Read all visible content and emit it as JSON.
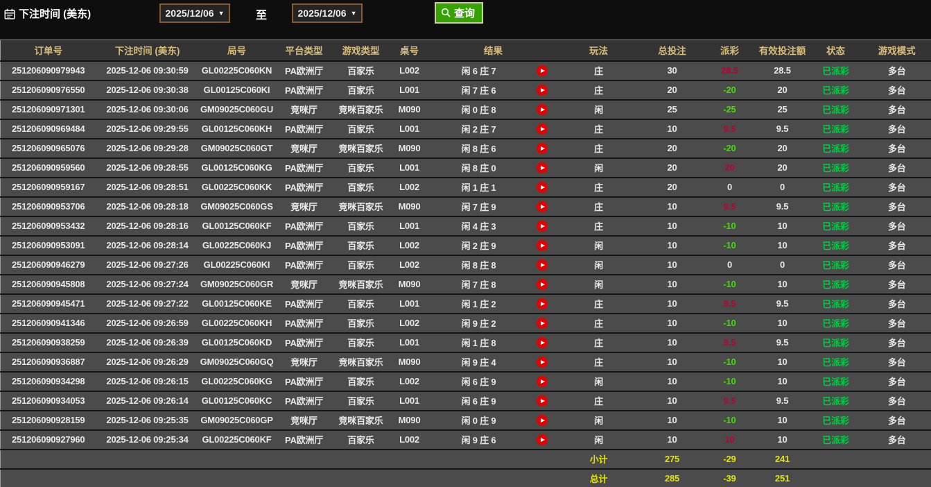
{
  "toolbar": {
    "title": "下注时间 (美东)",
    "date_from": "2025/12/06",
    "date_to": "2025/12/06",
    "to_label": "至",
    "search_label": "查询"
  },
  "colors": {
    "payout_win_red": "#c00031",
    "payout_loss_green": "#44dd00",
    "status_green": "#00cc44",
    "totals_yellow": "#e4e400",
    "header_text_tan": "#d8bc7a",
    "search_button_green": "#36a302",
    "date_border_brown": "#8a5a28",
    "play_button_red": "#e60000"
  },
  "table": {
    "headers": [
      "订单号",
      "下注时间 (美东)",
      "局号",
      "平台类型",
      "游戏类型",
      "桌号",
      "结果",
      "玩法",
      "总投注",
      "派彩",
      "有效投注额",
      "状态",
      "游戏模式"
    ],
    "rows": [
      {
        "order_id": "251206090979943",
        "bet_time": "2025-12-06 09:30:59",
        "round_id": "GL00225C060KN",
        "platform": "PA欧洲厅",
        "game_type": "百家乐",
        "table_no": "L002",
        "result": "闲 6 庄 7",
        "play_type": "庄",
        "total_bet": "30",
        "payout": "28.5",
        "payout_class": "win",
        "valid_bet": "28.5",
        "status": "已派彩",
        "mode": "多台"
      },
      {
        "order_id": "251206090976550",
        "bet_time": "2025-12-06 09:30:38",
        "round_id": "GL00125C060KI",
        "platform": "PA欧洲厅",
        "game_type": "百家乐",
        "table_no": "L001",
        "result": "闲 7 庄 6",
        "play_type": "庄",
        "total_bet": "20",
        "payout": "-20",
        "payout_class": "loss",
        "valid_bet": "20",
        "status": "已派彩",
        "mode": "多台"
      },
      {
        "order_id": "251206090971301",
        "bet_time": "2025-12-06 09:30:06",
        "round_id": "GM09025C060GU",
        "platform": "竞咪厅",
        "game_type": "竞咪百家乐",
        "table_no": "M090",
        "result": "闲 0 庄 8",
        "play_type": "闲",
        "total_bet": "25",
        "payout": "-25",
        "payout_class": "loss",
        "valid_bet": "25",
        "status": "已派彩",
        "mode": "多台"
      },
      {
        "order_id": "251206090969484",
        "bet_time": "2025-12-06 09:29:55",
        "round_id": "GL00125C060KH",
        "platform": "PA欧洲厅",
        "game_type": "百家乐",
        "table_no": "L001",
        "result": "闲 2 庄 7",
        "play_type": "庄",
        "total_bet": "10",
        "payout": "9.5",
        "payout_class": "win",
        "valid_bet": "9.5",
        "status": "已派彩",
        "mode": "多台"
      },
      {
        "order_id": "251206090965076",
        "bet_time": "2025-12-06 09:29:28",
        "round_id": "GM09025C060GT",
        "platform": "竞咪厅",
        "game_type": "竞咪百家乐",
        "table_no": "M090",
        "result": "闲 8 庄 6",
        "play_type": "庄",
        "total_bet": "20",
        "payout": "-20",
        "payout_class": "loss",
        "valid_bet": "20",
        "status": "已派彩",
        "mode": "多台"
      },
      {
        "order_id": "251206090959560",
        "bet_time": "2025-12-06 09:28:55",
        "round_id": "GL00125C060KG",
        "platform": "PA欧洲厅",
        "game_type": "百家乐",
        "table_no": "L001",
        "result": "闲 8 庄 0",
        "play_type": "闲",
        "total_bet": "20",
        "payout": "20",
        "payout_class": "win",
        "valid_bet": "20",
        "status": "已派彩",
        "mode": "多台"
      },
      {
        "order_id": "251206090959167",
        "bet_time": "2025-12-06 09:28:51",
        "round_id": "GL00225C060KK",
        "platform": "PA欧洲厅",
        "game_type": "百家乐",
        "table_no": "L002",
        "result": "闲 1 庄 1",
        "play_type": "庄",
        "total_bet": "20",
        "payout": "0",
        "payout_class": "zero",
        "valid_bet": "0",
        "status": "已派彩",
        "mode": "多台"
      },
      {
        "order_id": "251206090953706",
        "bet_time": "2025-12-06 09:28:18",
        "round_id": "GM09025C060GS",
        "platform": "竞咪厅",
        "game_type": "竞咪百家乐",
        "table_no": "M090",
        "result": "闲 7 庄 9",
        "play_type": "庄",
        "total_bet": "10",
        "payout": "9.5",
        "payout_class": "win",
        "valid_bet": "9.5",
        "status": "已派彩",
        "mode": "多台"
      },
      {
        "order_id": "251206090953432",
        "bet_time": "2025-12-06 09:28:16",
        "round_id": "GL00125C060KF",
        "platform": "PA欧洲厅",
        "game_type": "百家乐",
        "table_no": "L001",
        "result": "闲 4 庄 3",
        "play_type": "庄",
        "total_bet": "10",
        "payout": "-10",
        "payout_class": "loss",
        "valid_bet": "10",
        "status": "已派彩",
        "mode": "多台"
      },
      {
        "order_id": "251206090953091",
        "bet_time": "2025-12-06 09:28:14",
        "round_id": "GL00225C060KJ",
        "platform": "PA欧洲厅",
        "game_type": "百家乐",
        "table_no": "L002",
        "result": "闲 2 庄 9",
        "play_type": "闲",
        "total_bet": "10",
        "payout": "-10",
        "payout_class": "loss",
        "valid_bet": "10",
        "status": "已派彩",
        "mode": "多台"
      },
      {
        "order_id": "251206090946279",
        "bet_time": "2025-12-06 09:27:26",
        "round_id": "GL00225C060KI",
        "platform": "PA欧洲厅",
        "game_type": "百家乐",
        "table_no": "L002",
        "result": "闲 8 庄 8",
        "play_type": "闲",
        "total_bet": "10",
        "payout": "0",
        "payout_class": "zero",
        "valid_bet": "0",
        "status": "已派彩",
        "mode": "多台"
      },
      {
        "order_id": "251206090945808",
        "bet_time": "2025-12-06 09:27:24",
        "round_id": "GM09025C060GR",
        "platform": "竞咪厅",
        "game_type": "竞咪百家乐",
        "table_no": "M090",
        "result": "闲 7 庄 8",
        "play_type": "闲",
        "total_bet": "10",
        "payout": "-10",
        "payout_class": "loss",
        "valid_bet": "10",
        "status": "已派彩",
        "mode": "多台"
      },
      {
        "order_id": "251206090945471",
        "bet_time": "2025-12-06 09:27:22",
        "round_id": "GL00125C060KE",
        "platform": "PA欧洲厅",
        "game_type": "百家乐",
        "table_no": "L001",
        "result": "闲 1 庄 2",
        "play_type": "庄",
        "total_bet": "10",
        "payout": "9.5",
        "payout_class": "win",
        "valid_bet": "9.5",
        "status": "已派彩",
        "mode": "多台"
      },
      {
        "order_id": "251206090941346",
        "bet_time": "2025-12-06 09:26:59",
        "round_id": "GL00225C060KH",
        "platform": "PA欧洲厅",
        "game_type": "百家乐",
        "table_no": "L002",
        "result": "闲 9 庄 2",
        "play_type": "庄",
        "total_bet": "10",
        "payout": "-10",
        "payout_class": "loss",
        "valid_bet": "10",
        "status": "已派彩",
        "mode": "多台"
      },
      {
        "order_id": "251206090938259",
        "bet_time": "2025-12-06 09:26:39",
        "round_id": "GL00125C060KD",
        "platform": "PA欧洲厅",
        "game_type": "百家乐",
        "table_no": "L001",
        "result": "闲 1 庄 8",
        "play_type": "庄",
        "total_bet": "10",
        "payout": "9.5",
        "payout_class": "win",
        "valid_bet": "9.5",
        "status": "已派彩",
        "mode": "多台"
      },
      {
        "order_id": "251206090936887",
        "bet_time": "2025-12-06 09:26:29",
        "round_id": "GM09025C060GQ",
        "platform": "竞咪厅",
        "game_type": "竞咪百家乐",
        "table_no": "M090",
        "result": "闲 9 庄 4",
        "play_type": "庄",
        "total_bet": "10",
        "payout": "-10",
        "payout_class": "loss",
        "valid_bet": "10",
        "status": "已派彩",
        "mode": "多台"
      },
      {
        "order_id": "251206090934298",
        "bet_time": "2025-12-06 09:26:15",
        "round_id": "GL00225C060KG",
        "platform": "PA欧洲厅",
        "game_type": "百家乐",
        "table_no": "L002",
        "result": "闲 6 庄 9",
        "play_type": "闲",
        "total_bet": "10",
        "payout": "-10",
        "payout_class": "loss",
        "valid_bet": "10",
        "status": "已派彩",
        "mode": "多台"
      },
      {
        "order_id": "251206090934053",
        "bet_time": "2025-12-06 09:26:14",
        "round_id": "GL00125C060KC",
        "platform": "PA欧洲厅",
        "game_type": "百家乐",
        "table_no": "L001",
        "result": "闲 6 庄 9",
        "play_type": "庄",
        "total_bet": "10",
        "payout": "9.5",
        "payout_class": "win",
        "valid_bet": "9.5",
        "status": "已派彩",
        "mode": "多台"
      },
      {
        "order_id": "251206090928159",
        "bet_time": "2025-12-06 09:25:35",
        "round_id": "GM09025C060GP",
        "platform": "竞咪厅",
        "game_type": "竞咪百家乐",
        "table_no": "M090",
        "result": "闲 0 庄 9",
        "play_type": "闲",
        "total_bet": "10",
        "payout": "-10",
        "payout_class": "loss",
        "valid_bet": "10",
        "status": "已派彩",
        "mode": "多台"
      },
      {
        "order_id": "251206090927960",
        "bet_time": "2025-12-06 09:25:34",
        "round_id": "GL00225C060KF",
        "platform": "PA欧洲厅",
        "game_type": "百家乐",
        "table_no": "L002",
        "result": "闲 9 庄 6",
        "play_type": "闲",
        "total_bet": "10",
        "payout": "10",
        "payout_class": "win",
        "valid_bet": "10",
        "status": "已派彩",
        "mode": "多台"
      }
    ],
    "subtotal": {
      "label": "小计",
      "total_bet": "275",
      "payout": "-29",
      "valid_bet": "241"
    },
    "total": {
      "label": "总计",
      "total_bet": "285",
      "payout": "-39",
      "valid_bet": "251"
    }
  }
}
